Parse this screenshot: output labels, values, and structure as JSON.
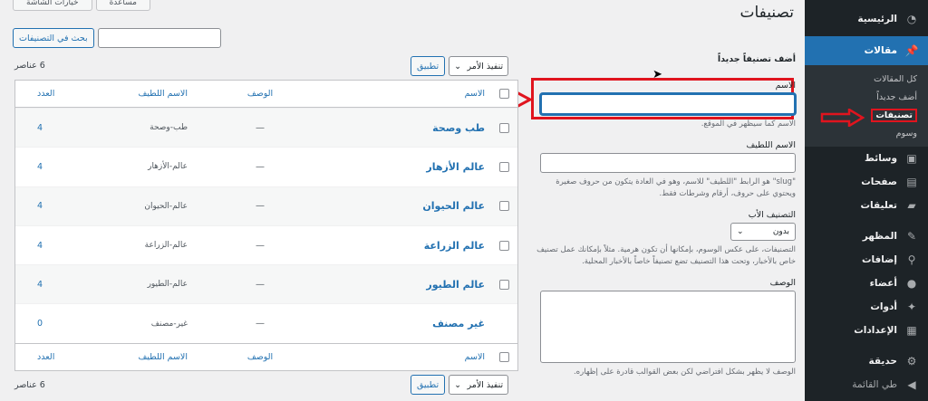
{
  "sidebar": {
    "items": [
      {
        "label": "الرئيسية",
        "icon": "dashboard-icon"
      },
      {
        "label": "مقالات",
        "icon": "pin-icon"
      },
      {
        "label": "وسائط",
        "icon": "media-icon"
      },
      {
        "label": "صفحات",
        "icon": "page-icon"
      },
      {
        "label": "تعليقات",
        "icon": "comment-icon"
      },
      {
        "label": "المظهر",
        "icon": "brush-icon"
      },
      {
        "label": "إضافات",
        "icon": "plugin-icon"
      },
      {
        "label": "أعضاء",
        "icon": "user-icon"
      },
      {
        "label": "أدوات",
        "icon": "wrench-icon"
      },
      {
        "label": "الإعدادات",
        "icon": "settings-icon"
      },
      {
        "label": "حديقة",
        "icon": "gear-icon"
      },
      {
        "label": "طي القائمة",
        "icon": "collapse-icon"
      }
    ],
    "submenu": [
      "كل المقالات",
      "أضف جديداً",
      "تصنيفات",
      "وسوم"
    ]
  },
  "header": {
    "title": "تصنيفات",
    "screen_options": "خيارات الشاشة",
    "help": "مساعدة"
  },
  "add_form": {
    "heading": "أضف تصنيفاً جديداً",
    "name_label": "الاسم",
    "name_hint": "الاسم كما سيظهر في الموقع.",
    "slug_label": "الاسم اللطيف",
    "slug_hint": "\"slug\" هو الرابط \"اللطيف\" للاسم، وهو في العادة يتكون من حروف صغيرة ويحتوي على حروف، أرقام وشرطات فقط.",
    "parent_label": "التصنيف الأب",
    "parent_value": "بدون",
    "parent_hint": "التصنيفات، على عكس الوسوم، بإمكانها أن تكون هرمية. مثلاً بإمكانك عمل تصنيف خاص بالأخبار، وتحت هذا التصنيف تضع تصنيفاً خاصاً بالأخبار المحلية.",
    "desc_label": "الوصف",
    "desc_hint": "الوصف لا يظهر بشكل افتراضي لكن بعض القوالب قادرة على إظهاره."
  },
  "list": {
    "search_button": "بحث في التصنيفات",
    "item_count": "6 عناصر",
    "bulk_action": "تنفيذ الأمر",
    "apply_button": "تطبيق",
    "columns": {
      "name": "الاسم",
      "description": "الوصف",
      "slug": "الاسم اللطيف",
      "count": "العدد"
    },
    "rows": [
      {
        "name": "طب وصحة",
        "description": "—",
        "slug": "طب-وصحة",
        "count": "4"
      },
      {
        "name": "عالم الأزهار",
        "description": "—",
        "slug": "عالم-الأزهار",
        "count": "4"
      },
      {
        "name": "عالم الحيوان",
        "description": "—",
        "slug": "عالم-الحيوان",
        "count": "4"
      },
      {
        "name": "عالم الزراعة",
        "description": "—",
        "slug": "عالم-الزراعة",
        "count": "4"
      },
      {
        "name": "عالم الطيور",
        "description": "—",
        "slug": "عالم-الطيور",
        "count": "4"
      },
      {
        "name": "غير مصنف",
        "description": "—",
        "slug": "غير-مصنف",
        "count": "0"
      }
    ]
  },
  "colors": {
    "accent": "#2271b1",
    "sidebar_bg": "#1d2327",
    "annotation": "#e0141e"
  }
}
